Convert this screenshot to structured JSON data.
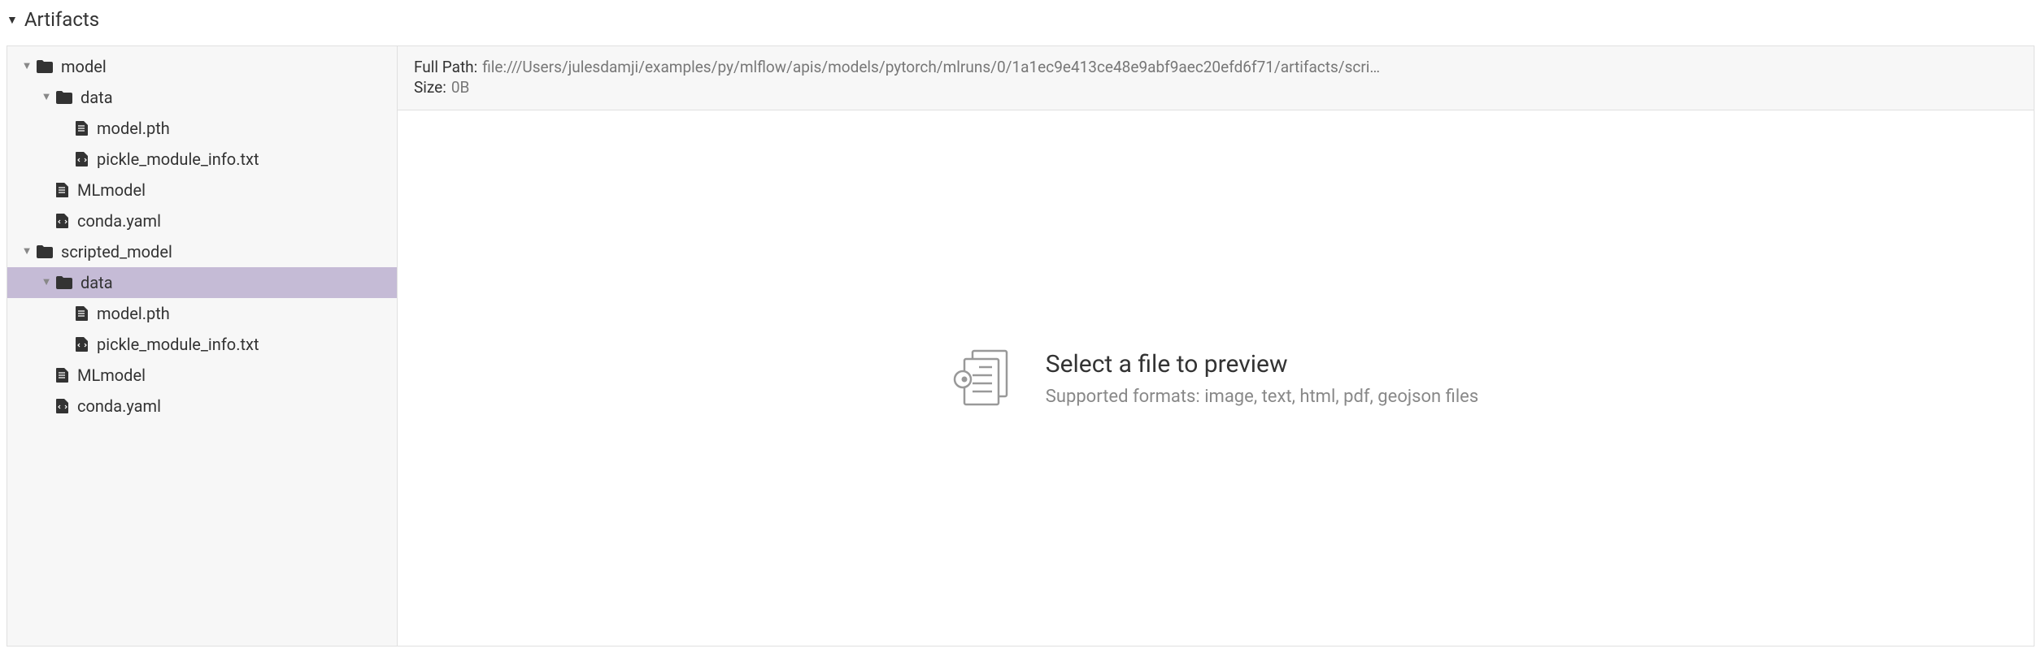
{
  "section": {
    "title": "Artifacts"
  },
  "tree": {
    "model": {
      "name": "model",
      "data": {
        "name": "data",
        "model_pth": "model.pth",
        "pickle_info": "pickle_module_info.txt"
      },
      "mlmodel": "MLmodel",
      "conda": "conda.yaml"
    },
    "scripted_model": {
      "name": "scripted_model",
      "data": {
        "name": "data",
        "model_pth": "model.pth",
        "pickle_info": "pickle_module_info.txt"
      },
      "mlmodel": "MLmodel",
      "conda": "conda.yaml"
    }
  },
  "info": {
    "full_path_label": "Full Path:",
    "full_path_value": "file:///Users/julesdamji/examples/py/mlflow/apis/models/pytorch/mlruns/0/1a1ec9e413ce48e9abf9aec20efd6f71/artifacts/scri…",
    "size_label": "Size:",
    "size_value": "0B"
  },
  "preview": {
    "title": "Select a file to preview",
    "subtitle": "Supported formats: image, text, html, pdf, geojson files"
  }
}
